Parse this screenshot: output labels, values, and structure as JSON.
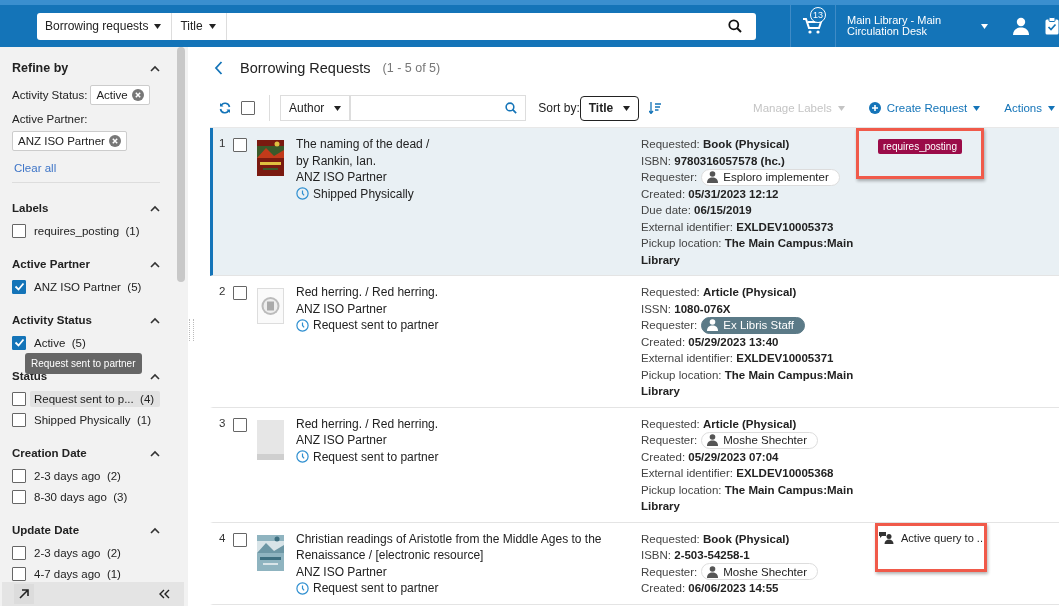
{
  "top_bar": {
    "search_scope": "Borrowing requests",
    "search_field": "Title",
    "cart_count": "13",
    "location": "Main Library - Main Circulation Desk"
  },
  "sidebar": {
    "title": "Refine by",
    "expanded": true,
    "active_filters": [
      {
        "label": "Activity Status:",
        "value": "Active"
      },
      {
        "label": "Active Partner:",
        "value": "ANZ ISO Partner"
      }
    ],
    "clear_all": "Clear all",
    "facets": [
      {
        "title": "Labels",
        "expanded": true,
        "options": [
          {
            "label": "requires_posting",
            "count": "(1)",
            "checked": false,
            "highlighted": false
          }
        ]
      },
      {
        "title": "Active Partner",
        "expanded": true,
        "options": [
          {
            "label": "ANZ ISO Partner",
            "count": "(5)",
            "checked": true,
            "highlighted": false
          }
        ]
      },
      {
        "title": "Activity Status",
        "expanded": true,
        "options": [
          {
            "label": "Active",
            "count": "(5)",
            "checked": true,
            "highlighted": false
          }
        ]
      },
      {
        "title": "Status",
        "expanded": true,
        "options": [
          {
            "label": "Request sent to p...",
            "count": "(4)",
            "checked": false,
            "highlighted": true
          },
          {
            "label": "Shipped Physically",
            "count": "(1)",
            "checked": false,
            "highlighted": false
          }
        ]
      },
      {
        "title": "Creation Date",
        "expanded": true,
        "options": [
          {
            "label": "2-3 days ago",
            "count": "(2)",
            "checked": false,
            "highlighted": false
          },
          {
            "label": "8-30 days ago",
            "count": "(3)",
            "checked": false,
            "highlighted": false
          }
        ]
      },
      {
        "title": "Update Date",
        "expanded": true,
        "options": [
          {
            "label": "2-3 days ago",
            "count": "(2)",
            "checked": false,
            "highlighted": false
          },
          {
            "label": "4-7 days ago",
            "count": "(1)",
            "checked": false,
            "highlighted": false
          }
        ]
      }
    ],
    "tooltip": "Request sent to partner"
  },
  "header": {
    "title": "Borrowing Requests",
    "count": "(1 - 5 of 5)"
  },
  "toolbar": {
    "select_all_checked": false,
    "filter_field": "Author",
    "sort_label": "Sort by:",
    "sort_field": "Title",
    "actions": [
      {
        "label": "Manage Labels",
        "disabled": true,
        "kind": "menu"
      },
      {
        "label": "Create Request",
        "disabled": false,
        "kind": "create"
      },
      {
        "label": "Actions",
        "disabled": false,
        "kind": "menu"
      }
    ]
  },
  "rows": [
    {
      "number": "1",
      "checked": false,
      "selected": true,
      "thumbnail": {
        "kind": "picture"
      },
      "title": "The naming of the dead /",
      "author": "by Rankin, Ian.",
      "partner": "ANZ ISO Partner",
      "status": "Shipped Physically",
      "details": [
        {
          "kind": "text",
          "label": "Requested:",
          "value": "Book (Physical)"
        },
        {
          "kind": "text",
          "label": "ISBN:",
          "value": "9780316057578 (hc.)"
        },
        {
          "kind": "requester",
          "label": "Requester:",
          "value": "Esploro implementer",
          "active": false
        },
        {
          "kind": "text",
          "label": "Created:",
          "value": "05/31/2023 12:12"
        },
        {
          "kind": "text",
          "label": "Due date:",
          "value": "06/15/2019"
        },
        {
          "kind": "text",
          "label": "External identifier:",
          "value": "EXLDEV10005373"
        },
        {
          "kind": "text",
          "label": "Pickup location:",
          "value": "The Main Campus:Main Library"
        }
      ],
      "tag": {
        "kind": "label",
        "text": "requires_posting",
        "framed": true
      }
    },
    {
      "number": "2",
      "checked": false,
      "selected": false,
      "thumbnail": {
        "kind": "generic"
      },
      "title": "Red herring. / Red herring.",
      "partner": "ANZ ISO Partner",
      "status": "Request sent to partner",
      "details": [
        {
          "kind": "text",
          "label": "Requested:",
          "value": "Article (Physical)"
        },
        {
          "kind": "text",
          "label": "ISSN:",
          "value": "1080-076X"
        },
        {
          "kind": "requester",
          "label": "Requester:",
          "value": "Ex Libris Staff",
          "active": true
        },
        {
          "kind": "text",
          "label": "Created:",
          "value": "05/29/2023 13:40"
        },
        {
          "kind": "text",
          "label": "External identifier:",
          "value": "EXLDEV10005371"
        },
        {
          "kind": "text",
          "label": "Pickup location:",
          "value": "The Main Campus:Main Library"
        }
      ]
    },
    {
      "number": "3",
      "checked": false,
      "selected": false,
      "thumbnail": {
        "kind": "blank"
      },
      "title": "Red herring. / Red herring.",
      "partner": "ANZ ISO Partner",
      "status": "Request sent to partner",
      "details": [
        {
          "kind": "text",
          "label": "Requested:",
          "value": "Article (Physical)"
        },
        {
          "kind": "requester",
          "label": "Requester:",
          "value": "Moshe Shechter",
          "active": false
        },
        {
          "kind": "text",
          "label": "Created:",
          "value": "05/29/2023 07:04"
        },
        {
          "kind": "text",
          "label": "External identifier:",
          "value": "EXLDEV10005368"
        },
        {
          "kind": "text",
          "label": "Pickup location:",
          "value": "The Main Campus:Main Library"
        }
      ]
    },
    {
      "number": "4",
      "checked": false,
      "selected": false,
      "thumbnail": {
        "kind": "picture"
      },
      "title": "Christian readings of Aristotle from the Middle Ages to the Renaissance / [electronic resource]",
      "partner": "ANZ ISO Partner",
      "status": "Request sent to partner",
      "details": [
        {
          "kind": "text",
          "label": "Requested:",
          "value": "Book (Physical)"
        },
        {
          "kind": "text",
          "label": "ISBN:",
          "value": "2-503-54258-1"
        },
        {
          "kind": "requester",
          "label": "Requester:",
          "value": "Moshe Shechter",
          "active": false
        },
        {
          "kind": "text",
          "label": "Created:",
          "value": "06/06/2023 14:55"
        }
      ],
      "tag": {
        "kind": "query",
        "text": "Active query to ..",
        "framed": true
      }
    }
  ]
}
